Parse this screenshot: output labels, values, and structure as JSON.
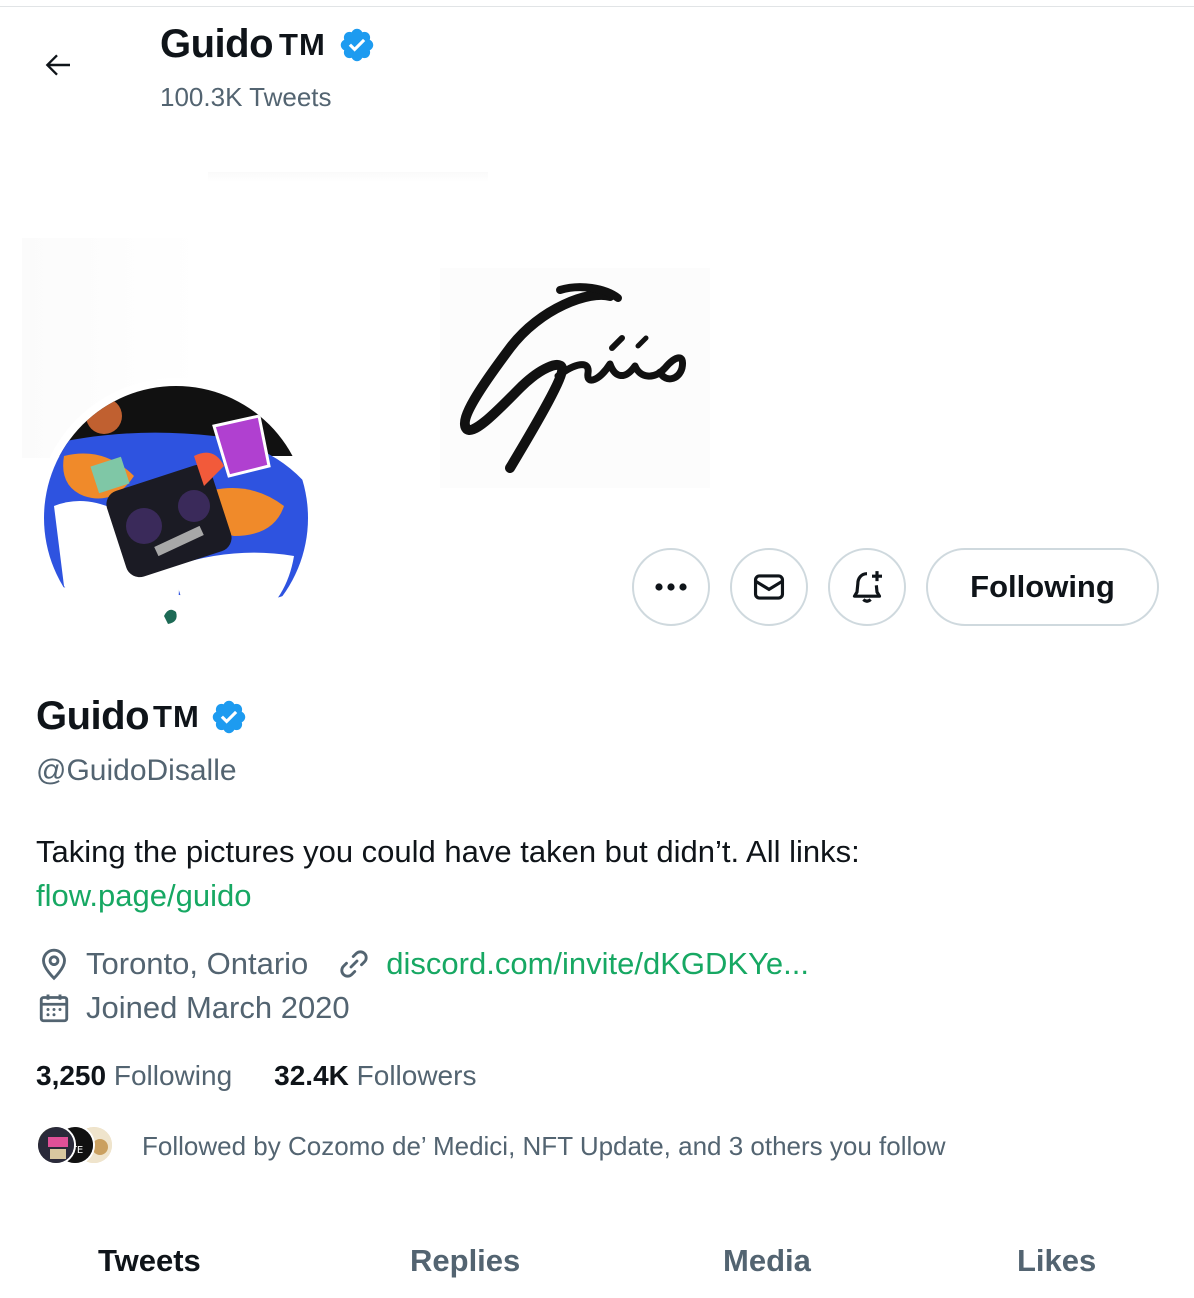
{
  "header": {
    "name": "Guido",
    "tm": "TM",
    "tweet_count": "100.3K Tweets"
  },
  "profile": {
    "name": "Guido",
    "tm": "TM",
    "handle": "@GuidoDisalle",
    "bio_text": "Taking the pictures you could have taken but didn’t.   All links:",
    "bio_link": "flow.page/guido",
    "location": "Toronto, Ontario",
    "website": "discord.com/invite/dKGDKYe...",
    "joined": "Joined March 2020",
    "following_count": "3,250",
    "following_label": "Following",
    "followers_count": "32.4K",
    "followers_label": "Followers",
    "followed_by": "Followed by Cozomo de’ Medici, NFT Update, and 3 others you follow"
  },
  "actions": {
    "follow_label": "Following"
  },
  "tabs": [
    "Tweets",
    "Replies",
    "Media",
    "Likes"
  ],
  "colors": {
    "link": "#17a863",
    "verified": "#1d9bf0",
    "secondary_text": "#536471",
    "border": "#cfd9de"
  }
}
